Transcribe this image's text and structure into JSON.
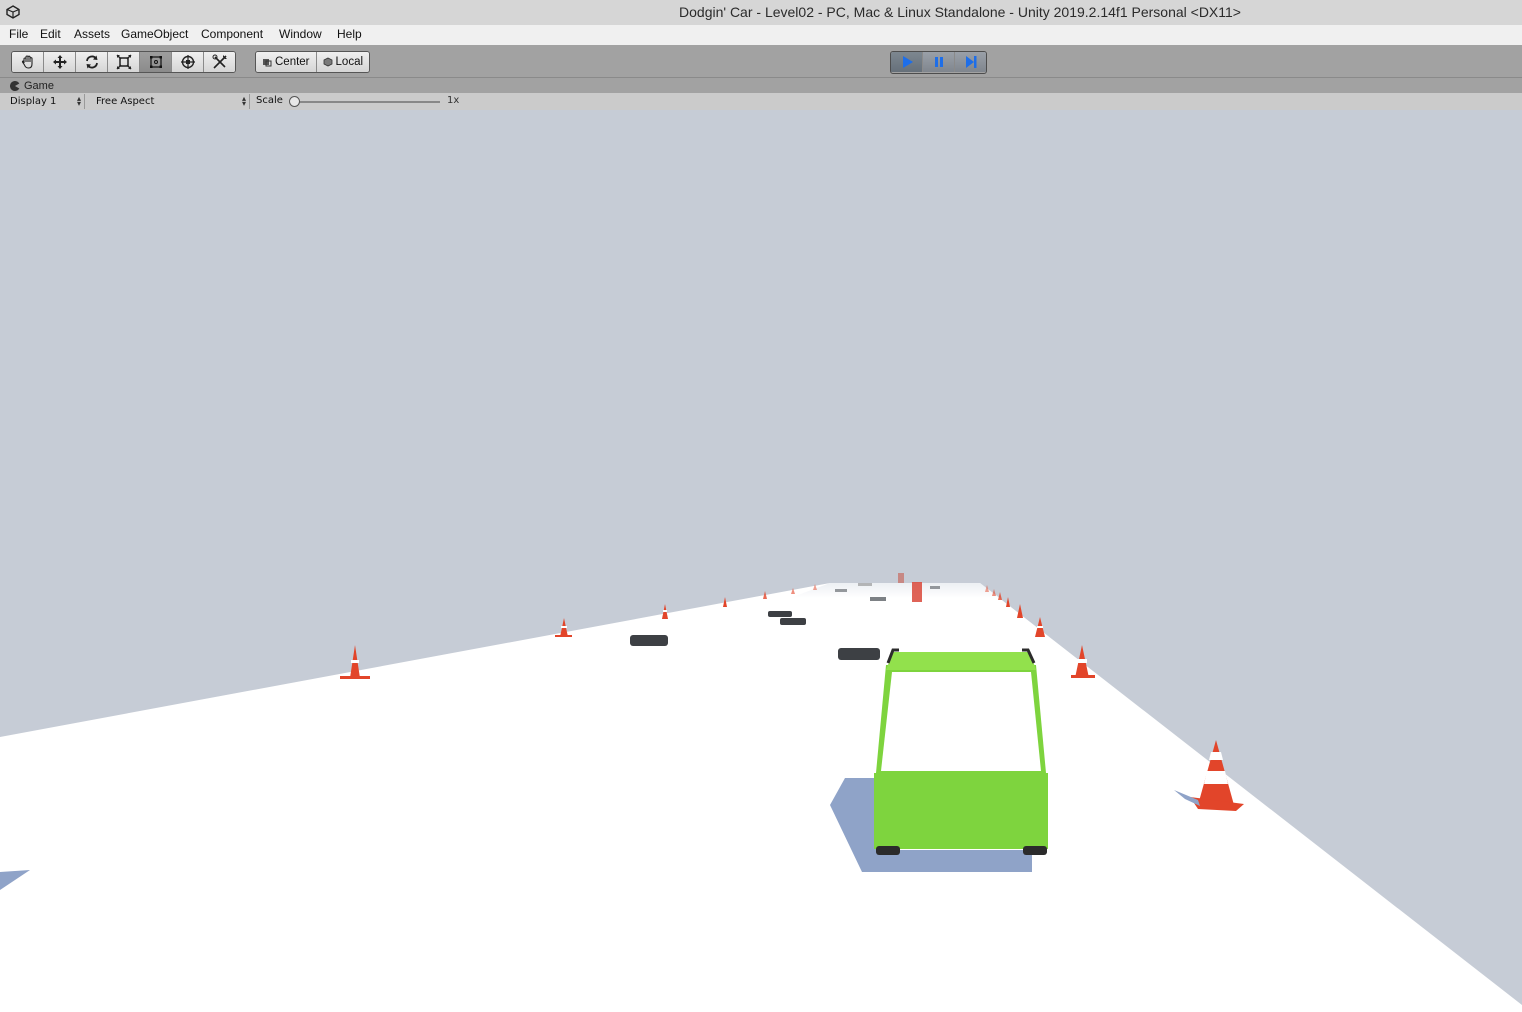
{
  "window": {
    "title": "Dodgin' Car - Level02 - PC, Mac & Linux Standalone - Unity 2019.2.14f1 Personal <DX11>"
  },
  "menu": [
    "File",
    "Edit",
    "Assets",
    "GameObject",
    "Component",
    "Window",
    "Help"
  ],
  "toolbar": {
    "tools": [
      {
        "name": "hand-tool",
        "icon": "hand-icon"
      },
      {
        "name": "move-tool",
        "icon": "move-icon"
      },
      {
        "name": "rotate-tool",
        "icon": "rotate-icon"
      },
      {
        "name": "scale-tool",
        "icon": "scale-icon"
      },
      {
        "name": "rect-tool",
        "icon": "rect-icon",
        "selected": true
      },
      {
        "name": "transform-tool",
        "icon": "transform-icon"
      },
      {
        "name": "custom-tool",
        "icon": "custom-tools-icon"
      }
    ],
    "pivot_label": "Center",
    "space_label": "Local",
    "play_state": "playing"
  },
  "game_view": {
    "tab_label": "Game",
    "display": "Display 1",
    "aspect": "Free Aspect",
    "scale_label": "Scale",
    "scale_value": "1x"
  },
  "colors": {
    "sky": "#c6ccd6",
    "road": "#ffffff",
    "car": "#7ed43e",
    "cone": "#e2452a",
    "play_active": "#1e6ee8"
  }
}
